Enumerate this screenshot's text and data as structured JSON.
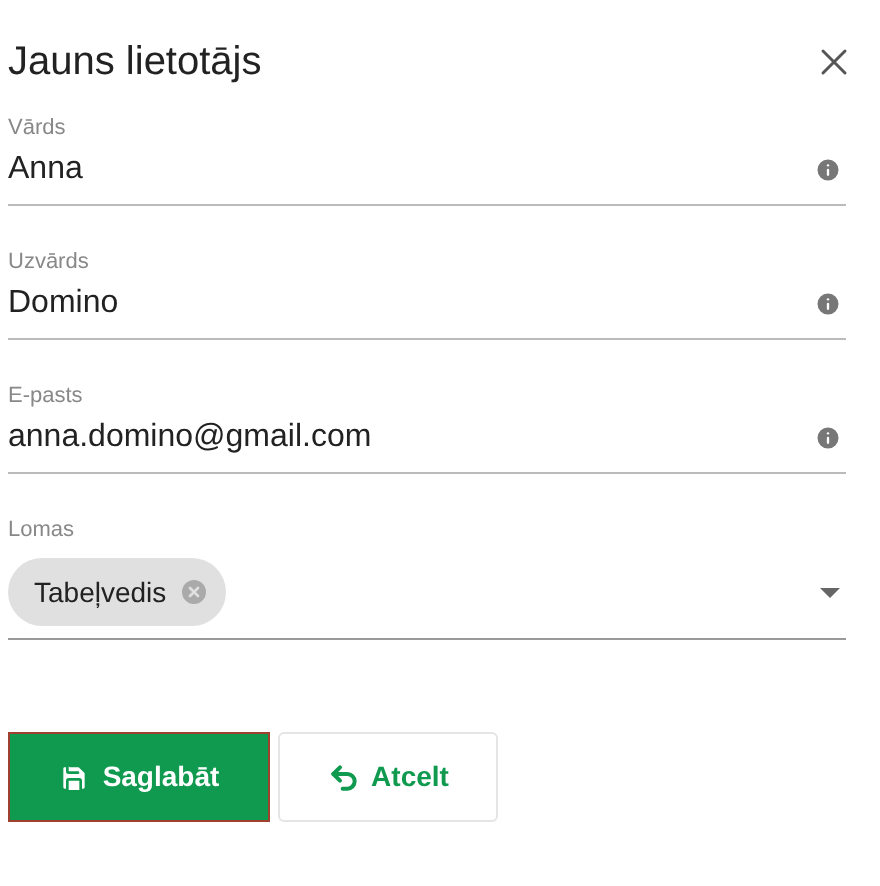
{
  "dialog": {
    "title": "Jauns lietotājs"
  },
  "fields": [
    {
      "label": "Vārds",
      "value": "Anna"
    },
    {
      "label": "Uzvārds",
      "value": "Domino"
    },
    {
      "label": "E-pasts",
      "value": "anna.domino@gmail.com"
    }
  ],
  "roles": {
    "label": "Lomas",
    "chips": [
      "Tabeļvedis"
    ]
  },
  "buttons": [
    {
      "kind": "primary",
      "label": "Saglabāt"
    },
    {
      "kind": "secondary",
      "label": "Atcelt"
    }
  ]
}
